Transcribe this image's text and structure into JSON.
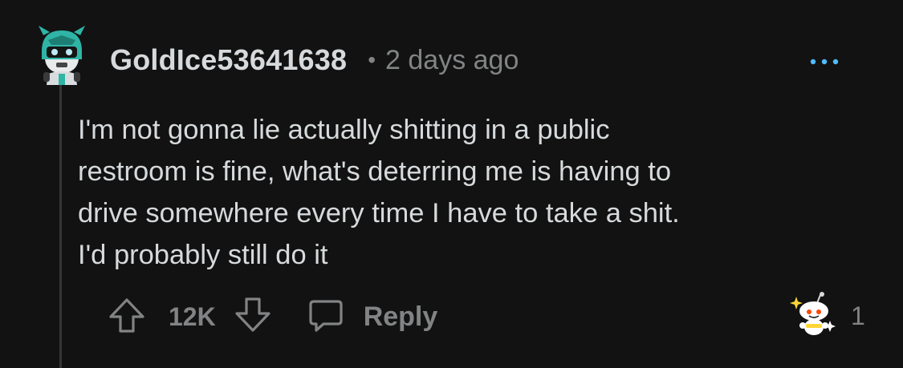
{
  "comment": {
    "username": "GoldIce53641638",
    "separator": "•",
    "timestamp": "2 days ago",
    "body": "I'm not gonna lie actually shitting in a public\nrestroom is fine, what's deterring me is having to\ndrive somewhere every time I have to take a shit.\nI'd probably still do it",
    "votes": "12K",
    "reply_label": "Reply",
    "award_count": "1"
  },
  "icons": {
    "more": "more-options-icon",
    "upvote": "upvote-arrow-icon",
    "downvote": "downvote-arrow-icon",
    "reply": "speech-bubble-icon",
    "award": "snoo-award-icon"
  },
  "colors": {
    "background": "#121212",
    "text": "#d7dadc",
    "muted": "#818384",
    "more_dots": "#4fbcff",
    "avatar_teal": "#2fb5a6"
  }
}
